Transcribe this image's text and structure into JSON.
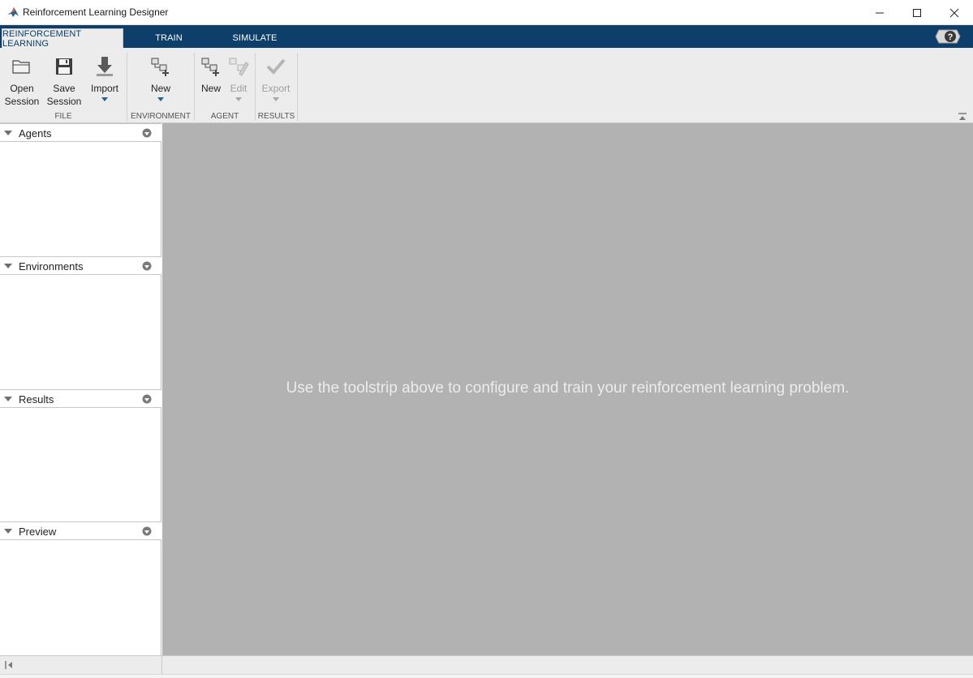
{
  "window": {
    "title": "Reinforcement Learning Designer"
  },
  "tabs": [
    {
      "label": "REINFORCEMENT LEARNING",
      "active": true
    },
    {
      "label": "TRAIN",
      "active": false
    },
    {
      "label": "SIMULATE",
      "active": false
    }
  ],
  "toolstrip": {
    "file": {
      "group_label": "FILE",
      "open_line1": "Open",
      "open_line2": "Session",
      "save_line1": "Save",
      "save_line2": "Session",
      "import_label": "Import"
    },
    "environment": {
      "group_label": "ENVIRONMENT",
      "new_label": "New"
    },
    "agent": {
      "group_label": "AGENT",
      "new_label": "New",
      "edit_label": "Edit"
    },
    "results": {
      "group_label": "RESULTS",
      "export_label": "Export"
    }
  },
  "panels": {
    "agents": "Agents",
    "environments": "Environments",
    "results": "Results",
    "preview": "Preview"
  },
  "main": {
    "hint": "Use the toolstrip above to configure and train your reinforcement learning problem."
  },
  "colors": {
    "tabbar": "#0e3e6a",
    "toolstrip": "#ececec",
    "workspace": "#b2b2b2",
    "hint_text": "#ececec"
  },
  "icons": [
    "matlab-logo-icon",
    "minimize-icon",
    "maximize-icon",
    "close-icon",
    "help-icon",
    "folder-icon",
    "save-icon",
    "import-icon",
    "new-environment-icon",
    "new-agent-icon",
    "edit-agent-icon",
    "export-check-icon",
    "collapse-toolstrip-icon",
    "panel-collapse-icon",
    "panel-menu-icon",
    "collapse-left-icon"
  ]
}
